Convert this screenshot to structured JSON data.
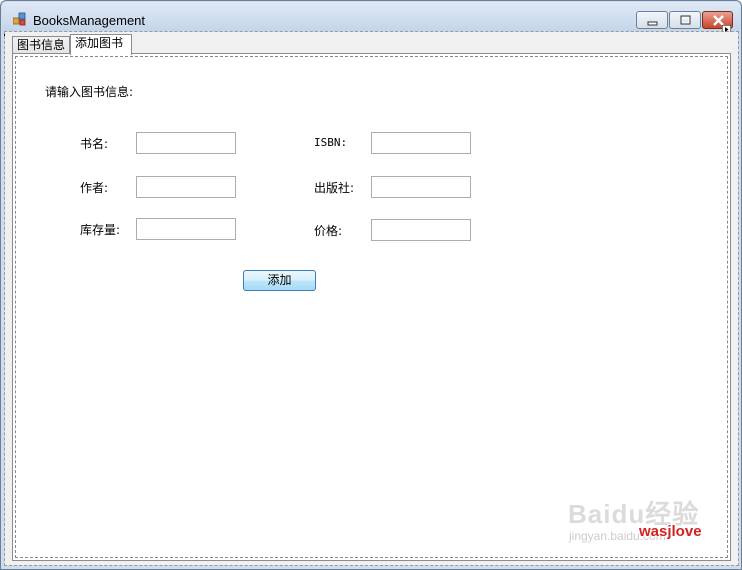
{
  "window": {
    "title": "BooksManagement"
  },
  "tabs": [
    {
      "label": "图书信息",
      "selected": false
    },
    {
      "label": "添加图书",
      "selected": true
    }
  ],
  "form": {
    "prompt": "请输入图书信息:",
    "fields": {
      "title": {
        "label": "书名:",
        "value": ""
      },
      "isbn": {
        "label": "ISBN:",
        "value": ""
      },
      "author": {
        "label": "作者:",
        "value": ""
      },
      "publisher": {
        "label": "出版社:",
        "value": ""
      },
      "stock": {
        "label": "库存量:",
        "value": ""
      },
      "price": {
        "label": "价格:",
        "value": ""
      }
    },
    "add_button": "添加"
  },
  "watermark": {
    "brand": "Baidu经验",
    "url": "jingyan.baidu.com",
    "user": "wasjlove"
  },
  "colors": {
    "titlebar": "#c4d5ea",
    "close_button": "#c7442c",
    "watermark_user": "#d52121"
  }
}
